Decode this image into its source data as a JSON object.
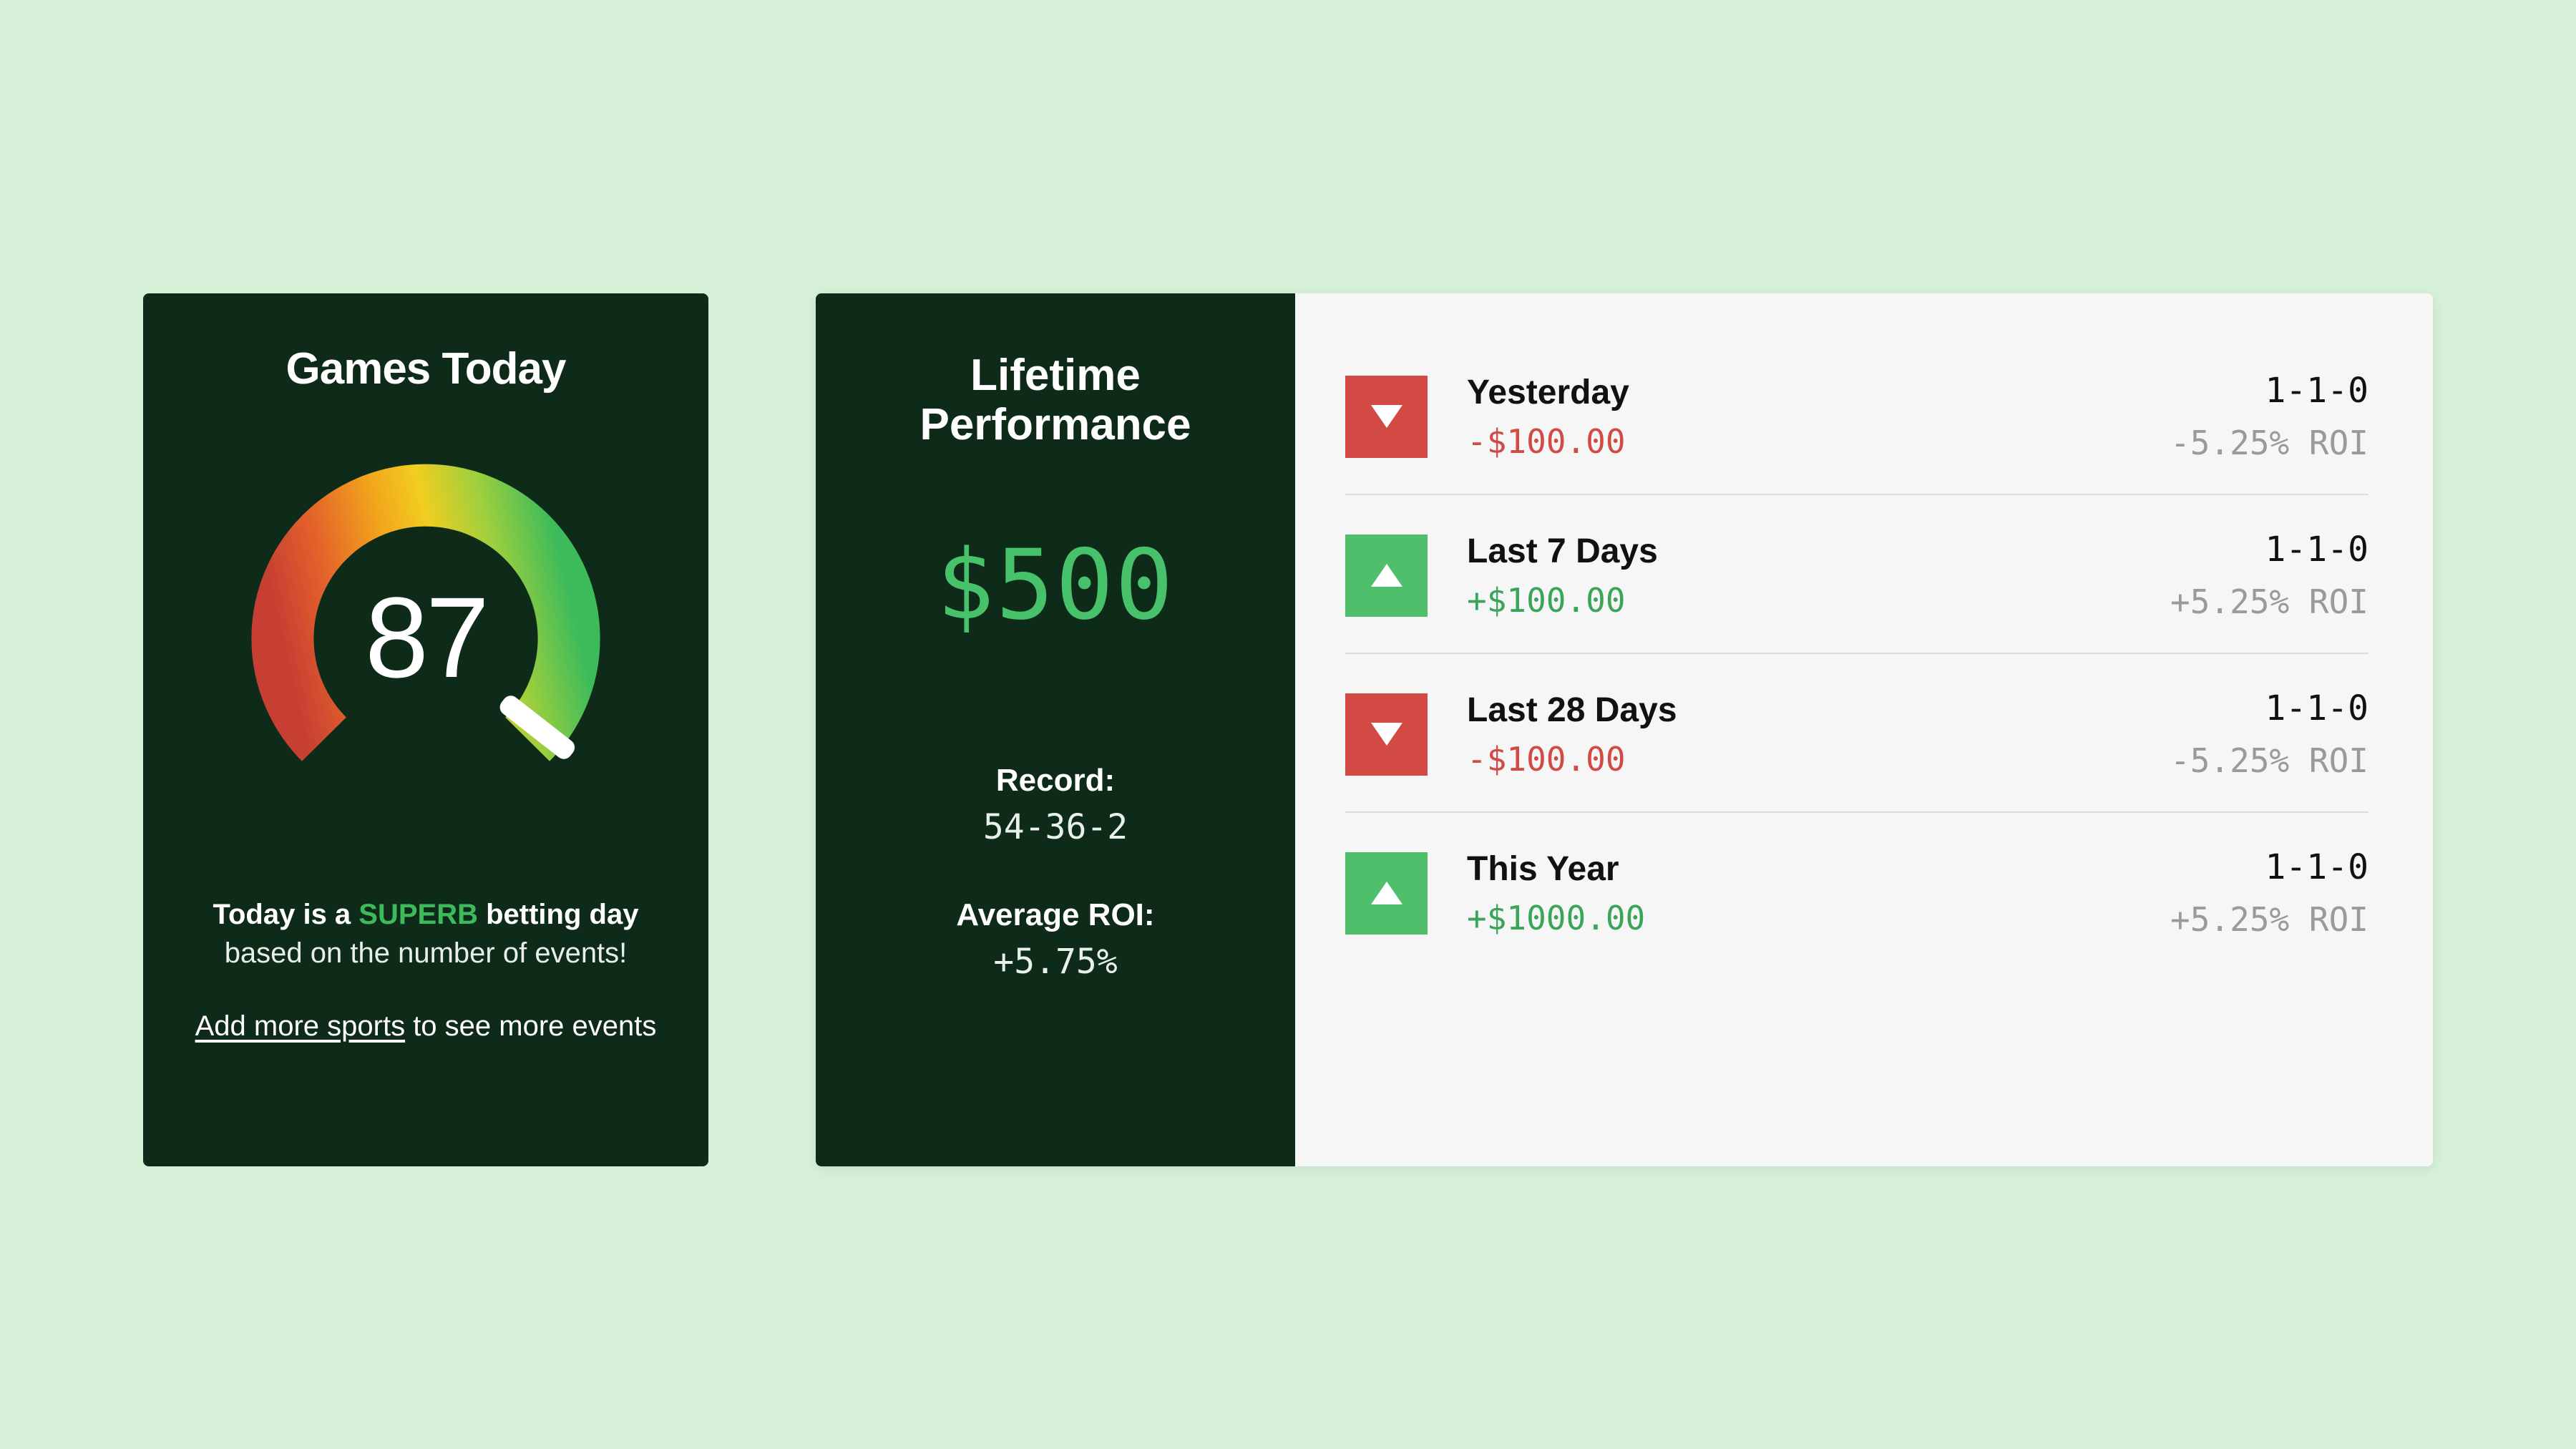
{
  "games": {
    "title": "Games Today",
    "count": "87",
    "caption_prefix": "Today is a ",
    "caption_highlight": "SUPERB",
    "caption_suffix": " betting day",
    "caption_line2": "based on the number of events!",
    "cta_link": "Add more sports",
    "cta_rest": " to see more events"
  },
  "lifetime": {
    "title_line1": "Lifetime",
    "title_line2": "Performance",
    "amount": "$500",
    "record_label": "Record:",
    "record_value": "54-36-2",
    "roi_label": "Average ROI:",
    "roi_value": "+5.75%"
  },
  "periods": [
    {
      "label": "Yesterday",
      "direction": "down",
      "amount": "-$100.00",
      "record": "1-1-0",
      "roi": "-5.25% ROI"
    },
    {
      "label": "Last 7 Days",
      "direction": "up",
      "amount": "+$100.00",
      "record": "1-1-0",
      "roi": "+5.25% ROI"
    },
    {
      "label": "Last 28 Days",
      "direction": "down",
      "amount": "-$100.00",
      "record": "1-1-0",
      "roi": "-5.25% ROI"
    },
    {
      "label": "This Year",
      "direction": "up",
      "amount": "+$1000.00",
      "record": "1-1-0",
      "roi": "+5.25% ROI"
    }
  ],
  "chart_data": {
    "type": "gauge",
    "title": "Games Today",
    "value": 87,
    "min": 0,
    "max": 100,
    "sweep_start_deg": 135,
    "sweep_end_deg": 405,
    "needle_angle_deg": 370,
    "color_stops": [
      "#c73f33",
      "#ef8a1f",
      "#f4c21b",
      "#8fcc3c",
      "#3bbb5c"
    ]
  }
}
